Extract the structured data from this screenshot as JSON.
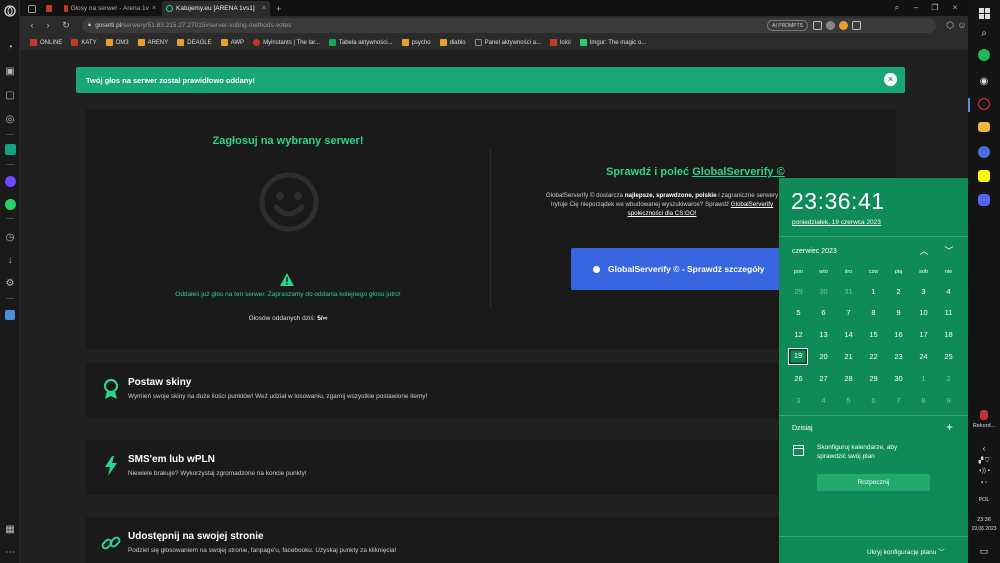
{
  "browser": {
    "tabs": [
      {
        "title": "",
        "icon": "opera-gx-icon"
      },
      {
        "title": "",
        "icon": "red-icon"
      },
      {
        "title": "Głosy na serwer - Arena 1v",
        "icon": "red-icon"
      },
      {
        "title": "Katujemy.eu [ARENA 1vs1]",
        "icon": "green-icon",
        "active": true
      }
    ],
    "new_tab": "+",
    "url_domain": "gosetti.pl",
    "url_path": "/serwery/51.83.215.27:27015#server-voting-methods-votes",
    "ai_prompts": "AI PROMPTS",
    "bookmarks": [
      {
        "label": "ONLINE",
        "color": "#c0392b"
      },
      {
        "label": "KATY",
        "color": "#c0392b"
      },
      {
        "label": "OM3",
        "color": "#e8a02c"
      },
      {
        "label": "ARENY",
        "color": "#e8a02c"
      },
      {
        "label": "DEAGLE",
        "color": "#e8a02c"
      },
      {
        "label": "AWP",
        "color": "#e8a02c"
      },
      {
        "label": "Myinstants | The lar...",
        "color": "#c0392b"
      },
      {
        "label": "Tabela aktywności...",
        "color": "#17a35a"
      },
      {
        "label": "psycho",
        "color": "#e8a02c"
      },
      {
        "label": "diablo",
        "color": "#e8a02c"
      },
      {
        "label": "Panel aktywności a...",
        "color": "#888888"
      },
      {
        "label": "lolol",
        "color": "#c0392b"
      },
      {
        "label": "Imgur: The magic o...",
        "color": "#2ecc71"
      }
    ]
  },
  "page": {
    "alert_text": "Twój głos na serwer został prawidłowo oddany!",
    "alert_close": "×",
    "vote_title": "Zagłosuj na wybrany serwer!",
    "voted_message": "Oddałeś już głos na ten serwer. Zapraszamy do oddania kolejnego głosu jutro!",
    "votes_today_label": "Głosów oddanych dziś:",
    "votes_today_value": "5/∞",
    "gs_title_prefix": "Sprawdź i poleć",
    "gs_title_link": "GlobalServerify ©",
    "gs_desc_1": "GlobalServerify © dostarcza",
    "gs_desc_bold": "najlepsze, sprawdzone, polskie",
    "gs_desc_2": "i zagraniczne serwery",
    "gs_desc_3": "Irytuje Cię nieporządek we wbudowanej wyszukiwarce? Sprawdź",
    "gs_desc_link": "GlobalServerify",
    "gs_desc_4": "społeczności dla CS:GO!",
    "gs_button": "GlobalServerify © - Sprawdź szczegóły",
    "features": [
      {
        "title": "Postaw skiny",
        "desc": "Wymień swoje skiny na duże ilości punktów! Weź udział w losowaniu, zgarnij wszystkie postawione itemy!",
        "icon": "award-ribbon-icon"
      },
      {
        "title": "SMS'em lub wPLN",
        "desc": "Niewiele brakuje? Wykorzystaj zgromadzone na koncie punkty!",
        "icon": "lightning-icon"
      },
      {
        "title": "Udostępnij na swojej stronie",
        "desc": "Podziel się głosowaniem na swojej stronie, fanpage'u, facebooku. Uzyskaj punkty za kliknięcia!",
        "icon": "link-icon"
      }
    ]
  },
  "calendar": {
    "time": "23:36:41",
    "date_long": "poniedziałek, 19 czerwca 2023",
    "month": "czerwiec 2023",
    "weekdays": [
      "pon",
      "wto",
      "śro",
      "czw",
      "pią",
      "sob",
      "nie"
    ],
    "weeks": [
      [
        "29",
        "30",
        "31",
        "1",
        "2",
        "3",
        "4"
      ],
      [
        "5",
        "6",
        "7",
        "8",
        "9",
        "10",
        "11"
      ],
      [
        "12",
        "13",
        "14",
        "15",
        "16",
        "17",
        "18"
      ],
      [
        "19",
        "20",
        "21",
        "22",
        "23",
        "24",
        "25"
      ],
      [
        "26",
        "27",
        "28",
        "29",
        "30",
        "1",
        "2"
      ],
      [
        "3",
        "4",
        "5",
        "6",
        "7",
        "8",
        "9"
      ]
    ],
    "today_label": "Dzisiaj",
    "configure_text": "Skonfiguruj kalendarze, aby sprawdzić swój plan",
    "start_button": "Rozpocznij",
    "hide_plan": "Ukryj konfigurację planu"
  },
  "taskbar": {
    "rekord_label": "Rekord...",
    "lang": "POL",
    "time": "23:36",
    "date": "19.06.2023"
  },
  "colors": {
    "accent_green": "#2ad48c",
    "alert_green": "#17a674",
    "flyout_green": "#0f8b59",
    "button_blue": "#3766e0"
  }
}
